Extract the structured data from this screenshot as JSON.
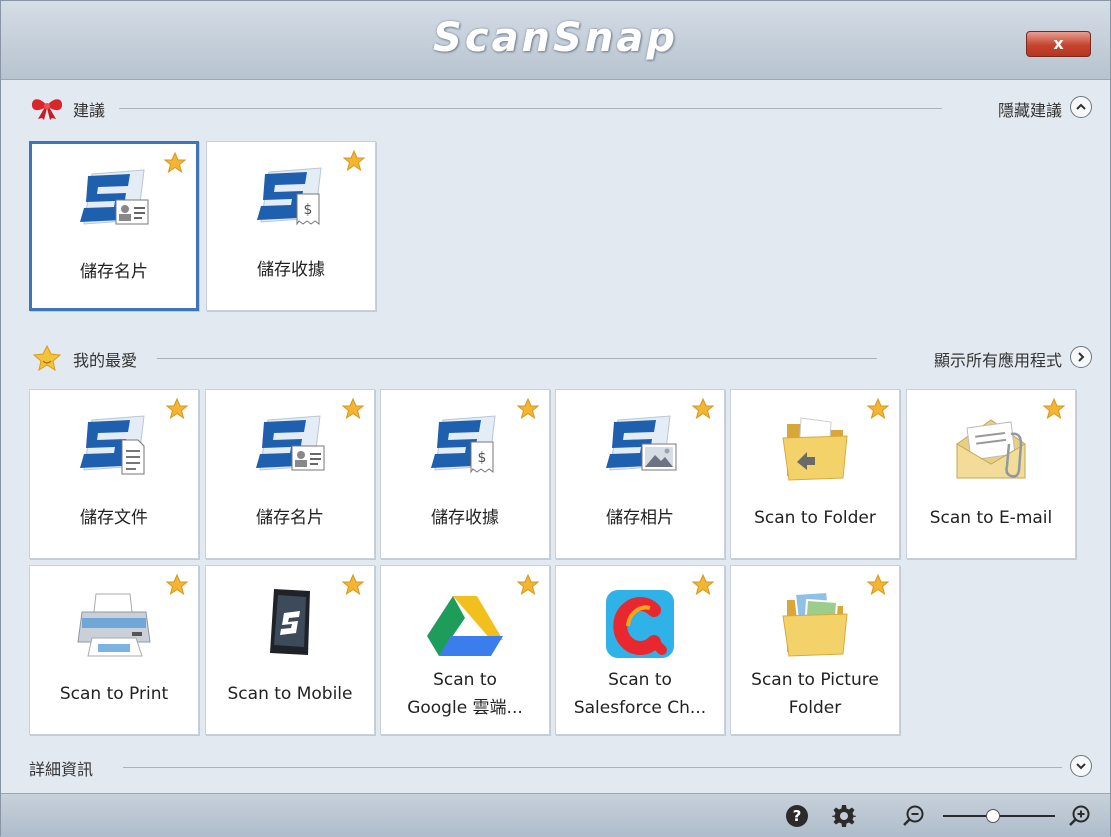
{
  "window": {
    "title": "ScanSnap",
    "close_label": "x"
  },
  "suggestions": {
    "title": "建議",
    "toggle_label": "隱藏建議",
    "tiles": [
      {
        "label": "儲存名片",
        "icon": "scansnap-business-card-icon",
        "selected": true
      },
      {
        "label": "儲存收據",
        "icon": "scansnap-receipt-icon",
        "selected": false
      }
    ]
  },
  "favorites": {
    "title": "我的最愛",
    "show_all_label": "顯示所有應用程式",
    "tiles": [
      {
        "label": "儲存文件",
        "icon": "scansnap-document-icon"
      },
      {
        "label": "儲存名片",
        "icon": "scansnap-business-card-icon"
      },
      {
        "label": "儲存收據",
        "icon": "scansnap-receipt-icon"
      },
      {
        "label": "儲存相片",
        "icon": "scansnap-photo-icon"
      },
      {
        "label": "Scan to Folder",
        "icon": "folder-icon"
      },
      {
        "label": "Scan to E-mail",
        "icon": "email-envelope-icon"
      },
      {
        "label": "Scan to Print",
        "icon": "printer-icon"
      },
      {
        "label": "Scan to Mobile",
        "icon": "mobile-tablet-icon"
      },
      {
        "label": "Scan to\nGoogle 雲端...",
        "icon": "google-drive-icon"
      },
      {
        "label": "Scan to\nSalesforce Ch...",
        "icon": "salesforce-chatter-icon"
      },
      {
        "label": "Scan to Picture\nFolder",
        "icon": "picture-folder-icon"
      }
    ]
  },
  "details": {
    "title": "詳細資訊"
  },
  "footer": {
    "zoom_level": 0.45
  },
  "colors": {
    "selected_border": "#3d75b7",
    "star": "#f2b632",
    "close_button": "#c6442f",
    "scansnap_blue": "#1e5fae"
  }
}
